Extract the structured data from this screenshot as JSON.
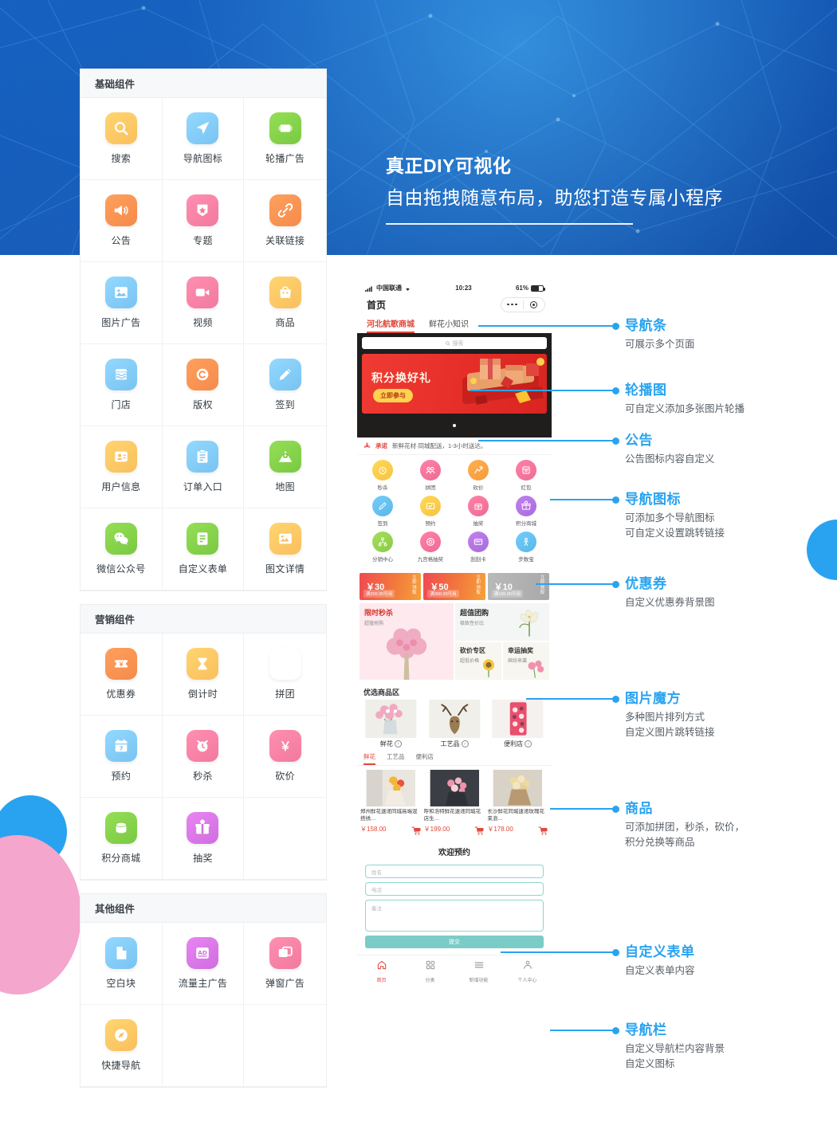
{
  "headline": {
    "line1": "真正DIY可视化",
    "line2": "自由拖拽随意布局，助您打造专属小程序"
  },
  "panels": [
    {
      "title": "基础组件",
      "items": [
        {
          "label": "搜索",
          "icon": "search-icon",
          "color": "#f9bf5e"
        },
        {
          "label": "导航图标",
          "icon": "navigation-icon",
          "color": "#79c3f2"
        },
        {
          "label": "轮播广告",
          "icon": "carousel-icon",
          "color": "#7ac943"
        },
        {
          "label": "公告",
          "icon": "megaphone-icon",
          "color": "#f58a4b"
        },
        {
          "label": "专题",
          "icon": "badge-star-icon",
          "color": "#f2799f"
        },
        {
          "label": "关联链接",
          "icon": "link-icon",
          "color": "#f58a4b"
        },
        {
          "label": "图片广告",
          "icon": "image-icon",
          "color": "#79c3f2"
        },
        {
          "label": "视频",
          "icon": "video-icon",
          "color": "#f2799f"
        },
        {
          "label": "商品",
          "icon": "bag-icon",
          "color": "#f9bf5e"
        },
        {
          "label": "门店",
          "icon": "store-icon",
          "color": "#79c3f2"
        },
        {
          "label": "版权",
          "icon": "copyright-icon",
          "color": "#f58a4b"
        },
        {
          "label": "签到",
          "icon": "pencil-icon",
          "color": "#79c3f2"
        },
        {
          "label": "用户信息",
          "icon": "user-card-icon",
          "color": "#f9bf5e"
        },
        {
          "label": "订单入口",
          "icon": "clipboard-icon",
          "color": "#79c3f2"
        },
        {
          "label": "地图",
          "icon": "map-pin-icon",
          "color": "#7ac943"
        },
        {
          "label": "微信公众号",
          "icon": "wechat-icon",
          "color": "#7ac943"
        },
        {
          "label": "自定义表单",
          "icon": "form-icon",
          "color": "#7ac943"
        },
        {
          "label": "图文详情",
          "icon": "article-icon",
          "color": "#f9bf5e"
        }
      ]
    },
    {
      "title": "营销组件",
      "items": [
        {
          "label": "优惠券",
          "icon": "coupon-icon",
          "color": "#f58a4b"
        },
        {
          "label": "倒计时",
          "icon": "hourglass-icon",
          "color": "#f9bf5e"
        },
        {
          "label": "拼团",
          "icon": "group-icon",
          "color": "#c martians"
        },
        {
          "label": "预约",
          "icon": "calendar-icon",
          "color": "#79c3f2"
        },
        {
          "label": "秒杀",
          "icon": "alarm-icon",
          "color": "#f2799f"
        },
        {
          "label": "砍价",
          "icon": "yuan-icon",
          "color": "#f2799f"
        },
        {
          "label": "积分商城",
          "icon": "coins-icon",
          "color": "#7ac943"
        },
        {
          "label": "抽奖",
          "icon": "gift-icon",
          "color": "#cf6ee0"
        }
      ]
    },
    {
      "title": "其他组件",
      "items": [
        {
          "label": "空白块",
          "icon": "blank-page-icon",
          "color": "#79c3f2"
        },
        {
          "label": "流量主广告",
          "icon": "ad-icon",
          "color": "#cf6ee0"
        },
        {
          "label": "弹窗广告",
          "icon": "popup-icon",
          "color": "#f2799f"
        },
        {
          "label": "快捷导航",
          "icon": "compass-icon",
          "color": "#f9bf5e"
        }
      ]
    }
  ],
  "phone": {
    "status": {
      "carrier": "中国联通",
      "time": "10:23",
      "battery": "61%"
    },
    "nav_title": "首页",
    "top_tabs": [
      {
        "label": "河北航歌商城",
        "active": true
      },
      {
        "label": "鲜花小知识",
        "active": false
      }
    ],
    "search_placeholder": "搜索",
    "banner": {
      "title": "积分换好礼",
      "button": "立即参与"
    },
    "notice": {
      "lead": "承诺",
      "text": "新鲜花材·同城配送，1-3小时送达。"
    },
    "nav_icons": [
      {
        "label": "秒杀",
        "color": "#f6c344",
        "icon": "alarm-icon"
      },
      {
        "label": "拼团",
        "color": "#ee6b95",
        "icon": "group-icon"
      },
      {
        "label": "砍价",
        "color": "#f79a3c",
        "icon": "axe-icon"
      },
      {
        "label": "红包",
        "color": "#ee6b95",
        "icon": "redpacket-icon"
      },
      {
        "label": "签到",
        "color": "#5ab7e8",
        "icon": "pencil-icon"
      },
      {
        "label": "预约",
        "color": "#f6c344",
        "icon": "check-box-icon"
      },
      {
        "label": "抽奖",
        "color": "#ee6b95",
        "icon": "gift-box-icon"
      },
      {
        "label": "积分商城",
        "color": "#a86bdd",
        "icon": "gift-icon"
      },
      {
        "label": "分销中心",
        "color": "#8bc94a",
        "icon": "share-tree-icon"
      },
      {
        "label": "九宫格抽奖",
        "color": "#ee6b95",
        "icon": "wheel-icon"
      },
      {
        "label": "刮刮卡",
        "color": "#a86bdd",
        "icon": "scratch-card-icon"
      },
      {
        "label": "步数宝",
        "color": "#5ab7e8",
        "icon": "person-run-icon"
      }
    ],
    "coupons": [
      {
        "amount": "￥30",
        "condition": "满200.00可用",
        "action": "立即领取",
        "active": true
      },
      {
        "amount": "￥50",
        "condition": "满300.00可用",
        "action": "立即领取",
        "active": true
      },
      {
        "amount": "￥10",
        "condition": "满100.00可用",
        "action": "立即领取",
        "active": false
      }
    ],
    "cube": [
      {
        "title": "限时秒杀",
        "sub": "超值抢购"
      },
      {
        "title": "超值团购",
        "sub": "极致性价比"
      },
      {
        "title": "砍价专区",
        "sub": "超低价格"
      },
      {
        "title": "幸运抽奖",
        "sub": "缤纷来袭"
      }
    ],
    "section_title": "优选商品区",
    "categories": [
      {
        "label": "鲜花"
      },
      {
        "label": "工艺品"
      },
      {
        "label": "便利店"
      }
    ],
    "sub_tabs": [
      {
        "label": "鲜花",
        "active": true
      },
      {
        "label": "工艺品",
        "active": false
      },
      {
        "label": "便利店",
        "active": false
      }
    ],
    "products": [
      {
        "name": "郑州鲜花速递同城高端混搭绣…",
        "price": "￥158.00"
      },
      {
        "name": "呼和浩特鲜花速递同城花店生…",
        "price": "￥199.00"
      },
      {
        "name": "长沙鲜花同城速递玫瑰花束浪…",
        "price": "￥178.00"
      }
    ],
    "form": {
      "title": "欢迎预约",
      "name_placeholder": "姓名",
      "phone_placeholder": "电话",
      "remark_placeholder": "备注",
      "submit": "提交"
    },
    "bottom_nav": [
      {
        "label": "首页",
        "active": true,
        "icon": "home-icon"
      },
      {
        "label": "分类",
        "active": false,
        "icon": "grid-icon"
      },
      {
        "label": "新增功能",
        "active": false,
        "icon": "menu-icon"
      },
      {
        "label": "个人中心",
        "active": false,
        "icon": "person-icon"
      }
    ]
  },
  "annotations": [
    {
      "title": "导航条",
      "desc": "可展示多个页面"
    },
    {
      "title": "轮播图",
      "desc": "可自定义添加多张图片轮播"
    },
    {
      "title": "公告",
      "desc": "公告图标内容自定义"
    },
    {
      "title": "导航图标",
      "desc": "可添加多个导航图标\n可自定义设置跳转链接"
    },
    {
      "title": "优惠券",
      "desc": "自定义优惠券背景图"
    },
    {
      "title": "图片魔方",
      "desc": "多种图片排列方式\n自定义图片跳转链接"
    },
    {
      "title": "商品",
      "desc": "可添加拼团，秒杀，砍价，\n积分兑换等商品"
    },
    {
      "title": "自定义表单",
      "desc": "自定义表单内容"
    },
    {
      "title": "导航栏",
      "desc": "自定义导航栏内容背景\n自定义图标"
    }
  ],
  "colors": {
    "accent": "#29a3f0",
    "red": "#e0483c",
    "teal": "#7bccc6"
  }
}
